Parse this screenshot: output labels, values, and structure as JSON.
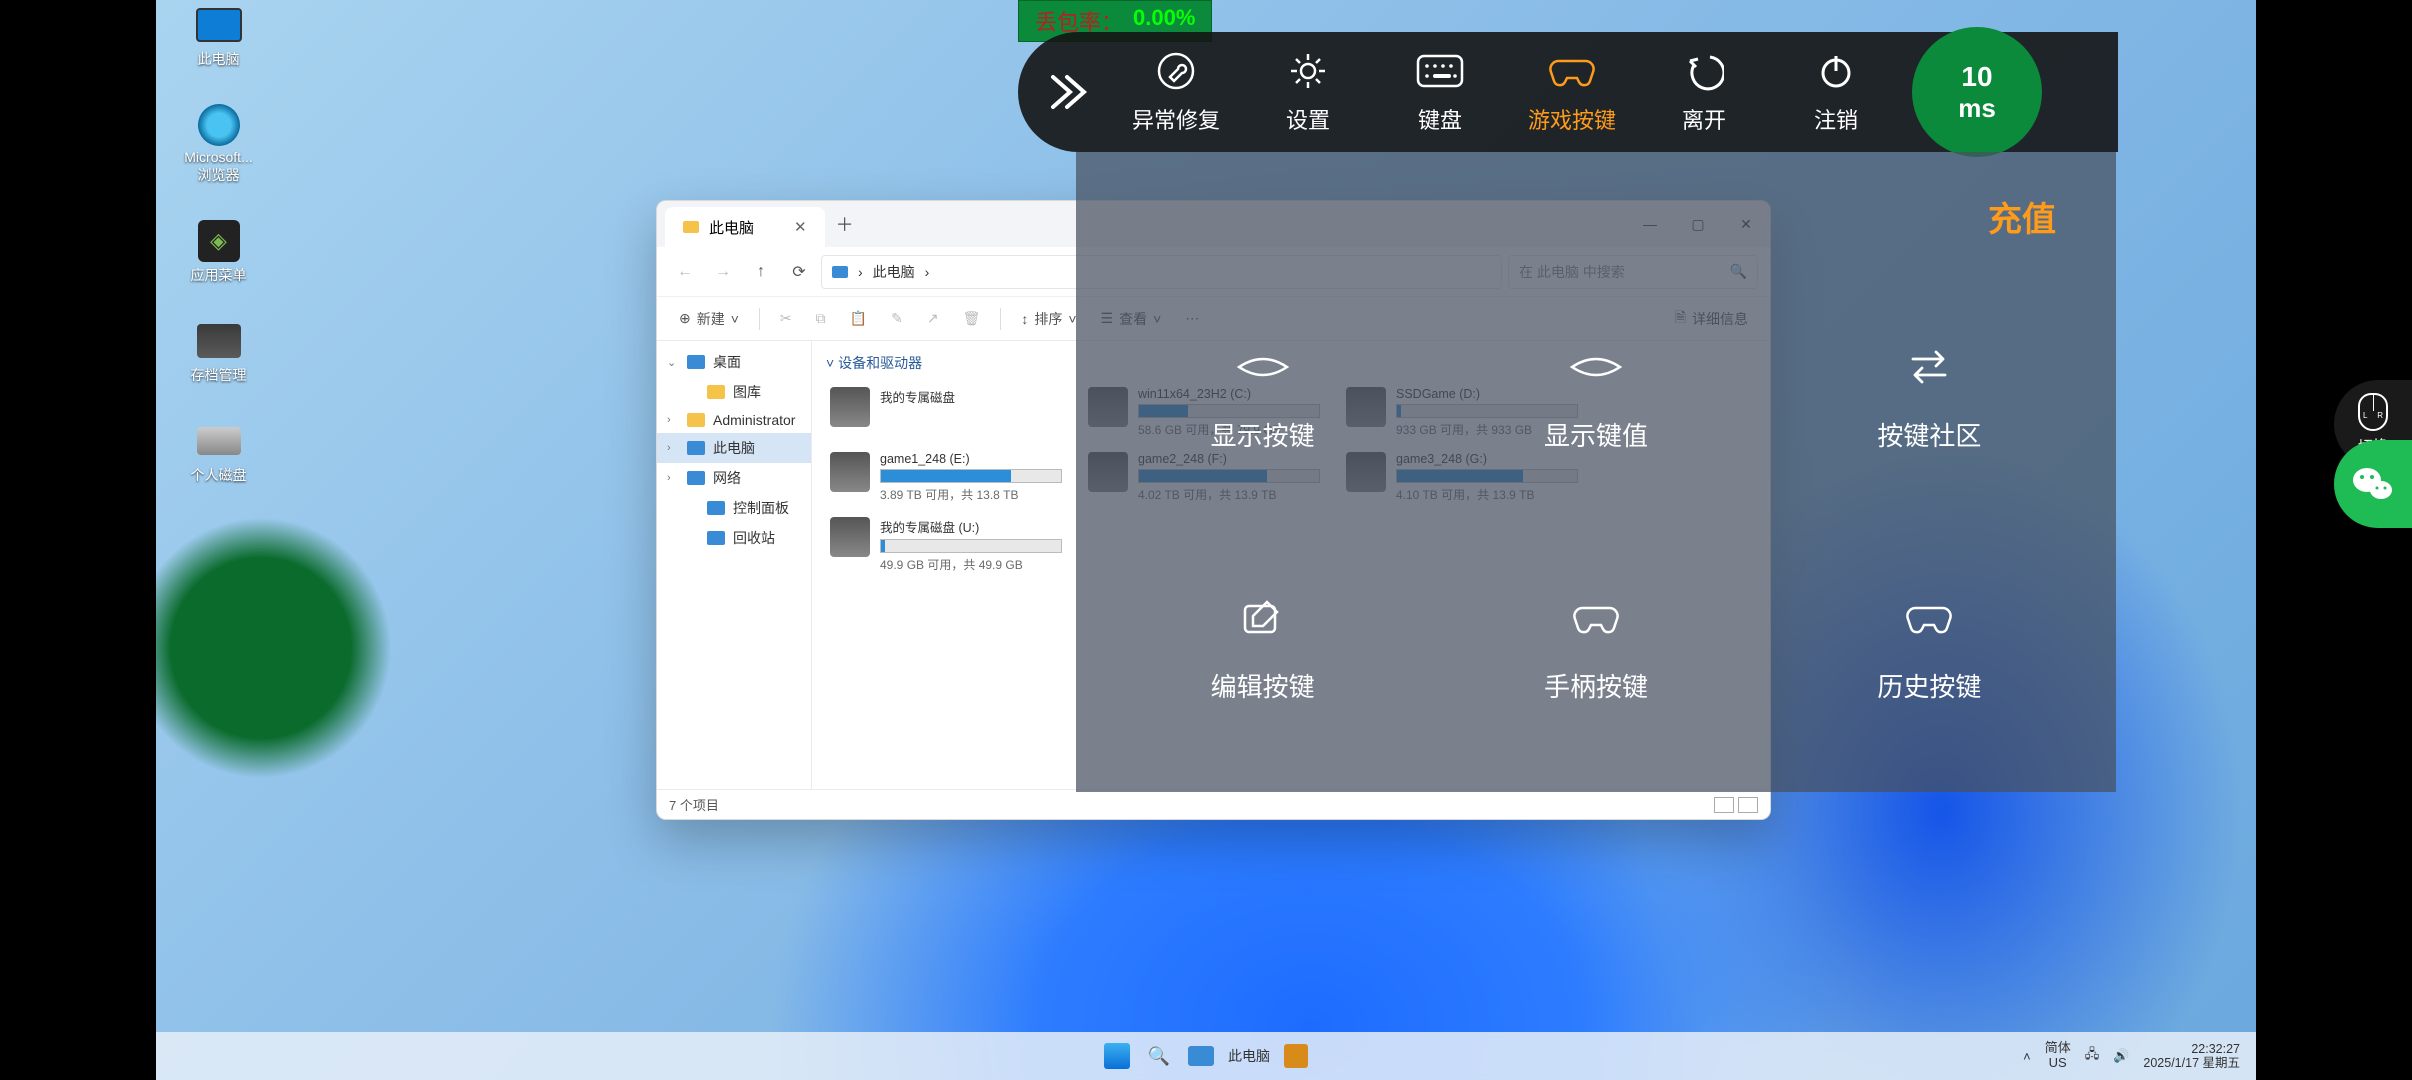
{
  "packet_loss": {
    "label": "丢包率：",
    "value": "0.00%"
  },
  "latency": {
    "value": "10",
    "unit": "ms"
  },
  "cloudbar": {
    "items": [
      {
        "label": "异常修复",
        "icon": "wrench"
      },
      {
        "label": "设置",
        "icon": "gear"
      },
      {
        "label": "键盘",
        "icon": "keyboard"
      },
      {
        "label": "游戏按键",
        "icon": "gamepad",
        "active": true
      },
      {
        "label": "离开",
        "icon": "back"
      },
      {
        "label": "注销",
        "icon": "power"
      }
    ]
  },
  "cloudpanel": {
    "recharge": "充值",
    "cells": [
      {
        "label": "显示按键",
        "icon": "eye"
      },
      {
        "label": "显示键值",
        "icon": "eye"
      },
      {
        "label": "按键社区",
        "icon": "swap"
      },
      {
        "label": "编辑按键",
        "icon": "edit"
      },
      {
        "label": "手柄按键",
        "icon": "gamepad"
      },
      {
        "label": "历史按键",
        "icon": "gamepad"
      }
    ]
  },
  "desktop": {
    "icons": [
      {
        "label": "此电脑",
        "type": "monitor"
      },
      {
        "label": "Microsoft...\n浏览器",
        "type": "edge"
      },
      {
        "label": "应用菜单",
        "type": "dark"
      },
      {
        "label": "存档管理",
        "type": "save"
      },
      {
        "label": "个人磁盘",
        "type": "disk"
      }
    ]
  },
  "explorer": {
    "tab_title": "此电脑",
    "breadcrumb": "此电脑",
    "search_placeholder": "在 此电脑 中搜索",
    "toolbar": {
      "new": "新建",
      "sort": "排序",
      "view": "查看",
      "details": "详细信息"
    },
    "nav": [
      {
        "label": "桌面",
        "expandable": true,
        "chev": "⌄",
        "icon": "mico"
      },
      {
        "label": "图库",
        "indent": true,
        "icon": "fico"
      },
      {
        "label": "Administrator",
        "expandable": true,
        "chev": "›",
        "icon": "fico"
      },
      {
        "label": "此电脑",
        "expandable": true,
        "chev": "›",
        "selected": true,
        "icon": "mico"
      },
      {
        "label": "网络",
        "expandable": true,
        "chev": "›",
        "icon": "mico"
      },
      {
        "label": "控制面板",
        "indent": true,
        "icon": "mico"
      },
      {
        "label": "回收站",
        "indent": true,
        "icon": "mico"
      }
    ],
    "section": "设备和驱动器",
    "drives": [
      {
        "name": "我的专属磁盘",
        "sub": "",
        "pct": 0,
        "nobar": true
      },
      {
        "name": "win11x64_23H2 (C:)",
        "sub": "58.6 GB 可用，共 79.9 GB",
        "pct": 27
      },
      {
        "name": "SSDGame (D:)",
        "sub": "933 GB 可用，共 933 GB",
        "pct": 2
      },
      {
        "name": "game1_248 (E:)",
        "sub": "3.89 TB 可用，共 13.8 TB",
        "pct": 72
      },
      {
        "name": "game2_248 (F:)",
        "sub": "4.02 TB 可用，共 13.9 TB",
        "pct": 71
      },
      {
        "name": "game3_248 (G:)",
        "sub": "4.10 TB 可用，共 13.9 TB",
        "pct": 70
      },
      {
        "name": "我的专属磁盘 (U:)",
        "sub": "49.9 GB 可用，共 49.9 GB",
        "pct": 2
      }
    ],
    "status": "7 个项目"
  },
  "taskbar": {
    "app_label": "此电脑",
    "lang1": "简体",
    "lang2": "US",
    "time": "22:32:27",
    "date": "2025/1/17 星期五"
  },
  "rfloat": {
    "switch": "切换"
  }
}
